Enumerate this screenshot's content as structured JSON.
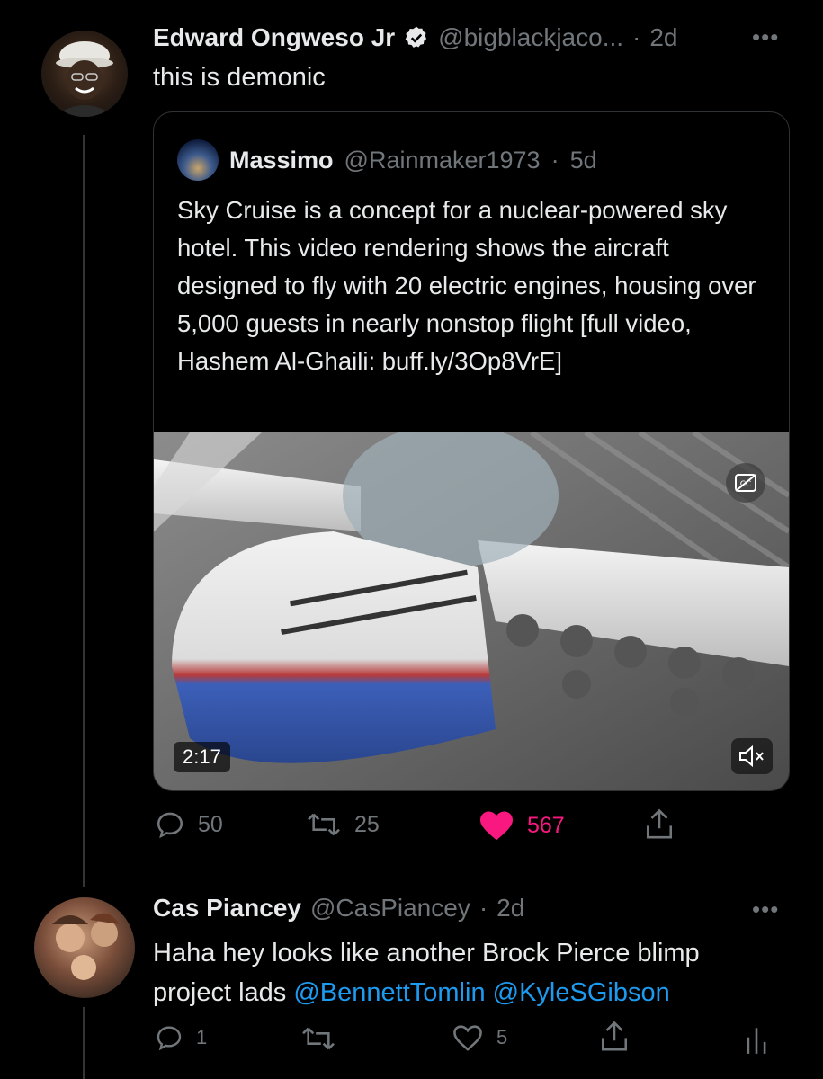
{
  "colors": {
    "background": "#000000",
    "text": "#e7e9ea",
    "muted": "#71767b",
    "like_active": "#f91880",
    "link": "#1d9bf0",
    "verified": "#e7e9ea"
  },
  "tweet1": {
    "author_name": "Edward Ongweso Jr",
    "verified_icon": "verified-badge-icon",
    "handle": "@bigblackjaco...",
    "separator": "·",
    "time": "2d",
    "more_icon": "more-dots-icon",
    "text": "this is demonic",
    "quote": {
      "author_name": "Massimo",
      "handle": "@Rainmaker1973",
      "separator": "·",
      "time": "5d",
      "text": "Sky Cruise is a concept for a nuclear-powered sky hotel. This video rendering shows the aircraft designed to fly with 20 electric engines, housing over 5,000 guests in nearly nonstop flight [full video, Hashem Al-Ghaili: buff.ly/3Op8VrE]",
      "video": {
        "duration": "2:17",
        "cc_icon": "closed-captions-off-icon",
        "mute_icon": "muted-speaker-icon"
      }
    },
    "actions": {
      "replies": "50",
      "retweets": "25",
      "likes": "567",
      "liked": true
    }
  },
  "tweet2": {
    "author_name": "Cas Piancey",
    "handle": "@CasPiancey",
    "separator": "·",
    "time": "2d",
    "more_icon": "more-dots-icon",
    "text_plain": "Haha hey looks like another Brock Pierce blimp project lads ",
    "mention1": "@BennettTomlin",
    "mention2": "@KyleSGibson",
    "actions": {
      "replies": "1",
      "retweets": "",
      "likes": "5"
    }
  }
}
